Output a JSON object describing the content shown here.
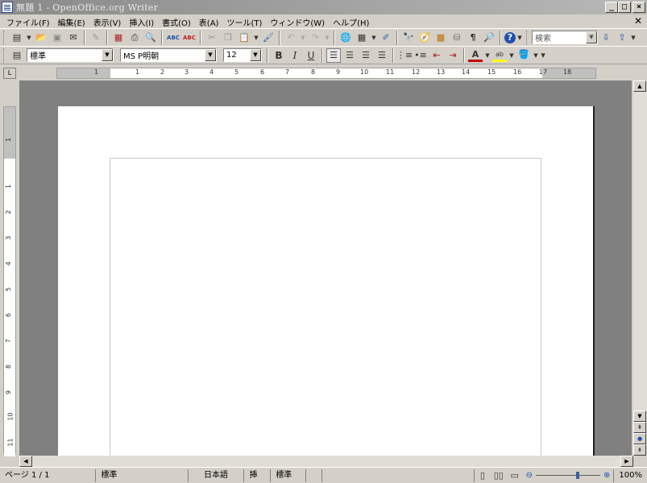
{
  "window": {
    "title": "無題 1 - OpenOffice.org Writer"
  },
  "menu": {
    "items": [
      "ファイル(F)",
      "編集(E)",
      "表示(V)",
      "挿入(I)",
      "書式(O)",
      "表(A)",
      "ツール(T)",
      "ウィンドウ(W)",
      "ヘルプ(H)"
    ]
  },
  "toolbar": {
    "search_placeholder": "検索"
  },
  "formatting": {
    "paragraph_style": "標準",
    "font_name": "MS P明朝",
    "font_size": "12",
    "bold": "B",
    "italic": "I",
    "underline": "U"
  },
  "ruler": {
    "h_numbers": [
      "1",
      "1",
      "2",
      "3",
      "4",
      "5",
      "6",
      "7",
      "8",
      "9",
      "10",
      "11",
      "12",
      "13",
      "14",
      "15",
      "16",
      "17",
      "18"
    ],
    "v_numbers": [
      "1",
      "1",
      "2",
      "3",
      "4",
      "5",
      "6",
      "7",
      "8",
      "9",
      "10",
      "11"
    ]
  },
  "statusbar": {
    "page": "ページ 1 / 1",
    "style": "標準",
    "language": "日本語",
    "insert_mode": "挿入",
    "selection_mode": "標準",
    "zoom": "100%"
  },
  "colors": {
    "title_bar": "#8a8a8a",
    "canvas": "#808080",
    "accent": "#3a5fa0"
  },
  "icons": [
    "new-document-icon",
    "open-icon",
    "save-icon",
    "email-icon",
    "edit-icon",
    "pdf-icon",
    "print-icon",
    "print-preview-icon",
    "spellcheck-icon",
    "autospell-icon",
    "cut-icon",
    "copy-icon",
    "paste-icon",
    "format-paintbrush-icon",
    "undo-icon",
    "redo-icon",
    "hyperlink-icon",
    "table-icon",
    "draw-icon",
    "find-icon",
    "navigator-icon",
    "gallery-icon",
    "datasource-icon",
    "nonprinting-chars-icon",
    "zoom-icon",
    "help-icon"
  ]
}
